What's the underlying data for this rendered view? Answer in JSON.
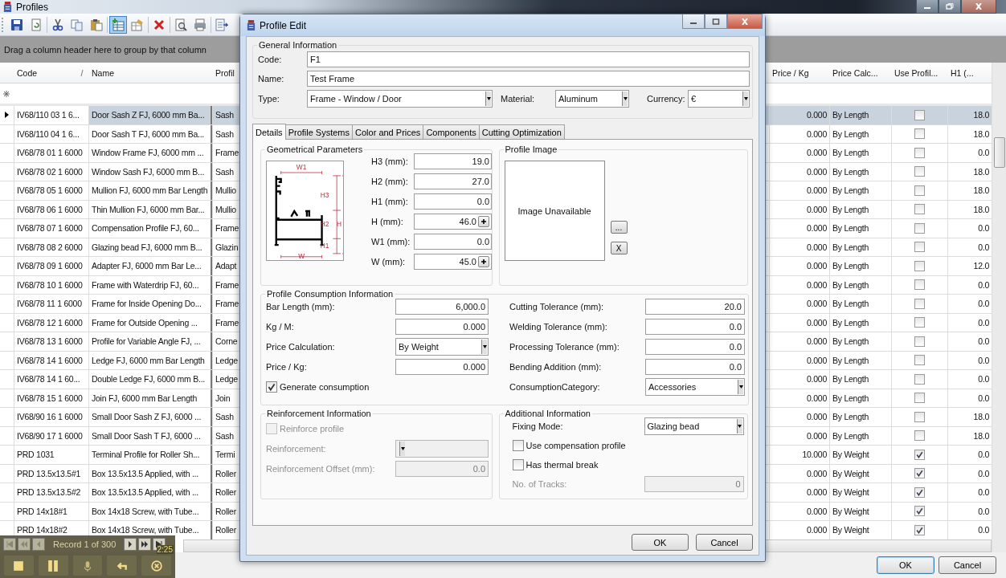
{
  "window": {
    "title": "Profiles"
  },
  "toolbar": [
    [
      {
        "kind": "save",
        "selected": false
      },
      {
        "kind": "refresh",
        "selected": false
      }
    ],
    [
      {
        "kind": "cut",
        "selected": false
      },
      {
        "kind": "copy",
        "selected": false
      },
      {
        "kind": "paste",
        "selected": false
      }
    ],
    [
      {
        "kind": "new",
        "selected": true
      },
      {
        "kind": "edit",
        "selected": false
      }
    ],
    [
      {
        "kind": "delete",
        "selected": false
      }
    ],
    [
      {
        "kind": "preview",
        "selected": false
      },
      {
        "kind": "print",
        "selected": false
      }
    ],
    [
      {
        "kind": "export",
        "selected": false
      }
    ]
  ],
  "group_hint": "Drag a column header here to group by that column",
  "table": {
    "columns_left": [
      {
        "label": "Code",
        "sorted": true
      },
      {
        "label": "Name",
        "sorted": false
      },
      {
        "label": "Profil",
        "sorted": false
      }
    ],
    "columns_right": [
      "Price / Kg",
      "Price Calc...",
      "Use Profil...",
      "H1 (..."
    ],
    "rows": [
      {
        "code": "IV68/110 03 1 6...",
        "name": "Door Sash Z FJ, 6000 mm Ba...",
        "profile": "Sash",
        "price": "0.000",
        "calc": "By Length",
        "use_profile": false,
        "h1": "18.0",
        "selected": true
      },
      {
        "code": "IV68/110 04 1 6...",
        "name": "Door Sash T FJ, 6000 mm Ba...",
        "profile": "Sash",
        "price": "0.000",
        "calc": "By Length",
        "use_profile": false,
        "h1": "18.0",
        "selected": false
      },
      {
        "code": "IV68/78 01 1 6000",
        "name": "Window Frame FJ, 6000 mm ...",
        "profile": "Frame",
        "price": "0.000",
        "calc": "By Length",
        "use_profile": false,
        "h1": "0.0",
        "selected": false
      },
      {
        "code": "IV68/78 02 1 6000",
        "name": "Window Sash FJ, 6000 mm B...",
        "profile": "Sash",
        "price": "0.000",
        "calc": "By Length",
        "use_profile": false,
        "h1": "18.0",
        "selected": false
      },
      {
        "code": "IV68/78 05 1 6000",
        "name": "Mullion FJ, 6000 mm Bar Length",
        "profile": "Mullio",
        "price": "0.000",
        "calc": "By Length",
        "use_profile": false,
        "h1": "18.0",
        "selected": false
      },
      {
        "code": "IV68/78 06 1 6000",
        "name": "Thin Mullion FJ, 6000 mm Bar...",
        "profile": "Mullio",
        "price": "0.000",
        "calc": "By Length",
        "use_profile": false,
        "h1": "18.0",
        "selected": false
      },
      {
        "code": "IV68/78 07 1 6000",
        "name": "Compensation Profile FJ, 60...",
        "profile": "Frame",
        "price": "0.000",
        "calc": "By Length",
        "use_profile": false,
        "h1": "0.0",
        "selected": false
      },
      {
        "code": "IV68/78 08 2 6000",
        "name": "Glazing bead FJ, 6000 mm B...",
        "profile": "Glazin",
        "price": "0.000",
        "calc": "By Length",
        "use_profile": false,
        "h1": "0.0",
        "selected": false
      },
      {
        "code": "IV68/78 09 1 6000",
        "name": "Adapter FJ, 6000 mm Bar Le...",
        "profile": "Adapt",
        "price": "0.000",
        "calc": "By Length",
        "use_profile": false,
        "h1": "12.0",
        "selected": false
      },
      {
        "code": "IV68/78 10 1 6000",
        "name": "Frame with Waterdrip FJ, 60...",
        "profile": "Frame",
        "price": "0.000",
        "calc": "By Length",
        "use_profile": false,
        "h1": "0.0",
        "selected": false
      },
      {
        "code": "IV68/78 11 1 6000",
        "name": "Frame for Inside Opening Do...",
        "profile": "Frame",
        "price": "0.000",
        "calc": "By Length",
        "use_profile": false,
        "h1": "0.0",
        "selected": false
      },
      {
        "code": "IV68/78 12 1 6000",
        "name": "Frame for Outside Opening ...",
        "profile": "Frame",
        "price": "0.000",
        "calc": "By Length",
        "use_profile": false,
        "h1": "0.0",
        "selected": false
      },
      {
        "code": "IV68/78 13 1 6000",
        "name": "Profile for Variable Angle FJ, ...",
        "profile": "Corne",
        "price": "0.000",
        "calc": "By Length",
        "use_profile": false,
        "h1": "0.0",
        "selected": false
      },
      {
        "code": "IV68/78 14 1 6000",
        "name": "Ledge FJ, 6000 mm Bar Length",
        "profile": "Ledge",
        "price": "0.000",
        "calc": "By Length",
        "use_profile": false,
        "h1": "0.0",
        "selected": false
      },
      {
        "code": "IV68/78 14 1 60...",
        "name": "Double Ledge FJ, 6000 mm B...",
        "profile": "Ledge",
        "price": "0.000",
        "calc": "By Length",
        "use_profile": false,
        "h1": "0.0",
        "selected": false
      },
      {
        "code": "IV68/78 15 1 6000",
        "name": "Join FJ, 6000 mm Bar Length",
        "profile": "Join",
        "price": "0.000",
        "calc": "By Length",
        "use_profile": false,
        "h1": "0.0",
        "selected": false
      },
      {
        "code": "IV68/90 16 1 6000",
        "name": "Small Door Sash Z FJ, 6000 ...",
        "profile": "Sash",
        "price": "0.000",
        "calc": "By Length",
        "use_profile": false,
        "h1": "18.0",
        "selected": false
      },
      {
        "code": "IV68/90 17 1 6000",
        "name": "Small Door Sash T FJ, 6000 ...",
        "profile": "Sash",
        "price": "0.000",
        "calc": "By Length",
        "use_profile": false,
        "h1": "18.0",
        "selected": false
      },
      {
        "code": "PRD 1031",
        "name": "Terminal Profile for Roller Sh...",
        "profile": "Termi",
        "price": "10.000",
        "calc": "By Weight",
        "use_profile": true,
        "h1": "0.0",
        "selected": false
      },
      {
        "code": "PRD 13.5x13.5#1",
        "name": "Box 13.5x13.5 Applied, with ...",
        "profile": "Roller",
        "price": "0.000",
        "calc": "By Weight",
        "use_profile": true,
        "h1": "0.0",
        "selected": false
      },
      {
        "code": "PRD 13.5x13.5#2",
        "name": "Box 13.5x13.5 Applied, with ...",
        "profile": "Roller",
        "price": "0.000",
        "calc": "By Weight",
        "use_profile": true,
        "h1": "0.0",
        "selected": false
      },
      {
        "code": "PRD 14x18#1",
        "name": "Box 14x18 Screw, with Tube...",
        "profile": "Roller",
        "price": "0.000",
        "calc": "By Weight",
        "use_profile": true,
        "h1": "0.0",
        "selected": false
      },
      {
        "code": "PRD 14x18#2",
        "name": "Box 14x18 Screw, with Tube...",
        "profile": "Roller",
        "price": "0.000",
        "calc": "By Weight",
        "use_profile": true,
        "h1": "0.0",
        "selected": false
      }
    ]
  },
  "navigator": {
    "record": "Record 1 of 300",
    "time": "2:25"
  },
  "buttons": [
    "OK",
    "Cancel"
  ],
  "dialog": {
    "title": "Profile Edit",
    "general": {
      "title": "General Information",
      "code": {
        "label": "Code:",
        "value": "F1"
      },
      "name": {
        "label": "Name:",
        "value": "Test Frame"
      },
      "type": {
        "label": "Type:",
        "value": "Frame - Window / Door"
      },
      "material": {
        "label": "Material:",
        "value": "Aluminum"
      },
      "currency": {
        "label": "Currency:",
        "value": "€"
      }
    },
    "tabs": [
      {
        "label": "Details",
        "selected": true
      },
      {
        "label": "Profile Systems",
        "selected": false
      },
      {
        "label": "Color and Prices",
        "selected": false
      },
      {
        "label": "Components",
        "selected": false
      },
      {
        "label": "Cutting Optimization",
        "selected": false
      }
    ],
    "geometry": {
      "title": "Geometrical Parameters",
      "diagram_labels": [
        "W1",
        "H3",
        "H2",
        "H1",
        "H",
        "W"
      ],
      "fields": [
        {
          "label": "H3 (mm):",
          "value": "19.0",
          "spin": false
        },
        {
          "label": "H2 (mm):",
          "value": "27.0",
          "spin": false
        },
        {
          "label": "H1 (mm):",
          "value": "0.0",
          "spin": false
        },
        {
          "label": "H (mm):",
          "value": "46.0",
          "spin": true
        },
        {
          "label": "W1 (mm):",
          "value": "0.0",
          "spin": false
        },
        {
          "label": "W (mm):",
          "value": "45.0",
          "spin": true
        }
      ]
    },
    "image": {
      "title": "Profile Image",
      "placeholder": "Image Unavailable",
      "buttons": [
        "...",
        "X"
      ]
    },
    "consumption": {
      "title": "Profile Consumption Information",
      "left": [
        {
          "kind": "input",
          "label": "Bar Length (mm):",
          "value": "6,000.0",
          "disabled": false
        },
        {
          "kind": "input",
          "label": "Kg / M:",
          "value": "0.000",
          "disabled": false
        },
        {
          "kind": "combo",
          "label": "Price Calculation:",
          "value": "By Weight",
          "disabled": false
        },
        {
          "kind": "input",
          "label": "Price / Kg:",
          "value": "0.000",
          "disabled": false
        },
        {
          "kind": "checkbox",
          "label": "Generate consumption",
          "checked": true,
          "disabled": false
        }
      ],
      "right": [
        {
          "kind": "input",
          "label": "Cutting Tolerance (mm):",
          "value": "20.0",
          "disabled": false
        },
        {
          "kind": "input",
          "label": "Welding Tolerance (mm):",
          "value": "0.0",
          "disabled": false
        },
        {
          "kind": "input",
          "label": "Processing Tolerance (mm):",
          "value": "0.0",
          "disabled": false
        },
        {
          "kind": "input",
          "label": "Bending Addition (mm):",
          "value": "0.0",
          "disabled": false
        },
        {
          "kind": "combo",
          "label": "ConsumptionCategory:",
          "value": "Accessories",
          "disabled": false
        }
      ]
    },
    "reinforcement": {
      "title": "Reinforcement Information",
      "items": [
        {
          "kind": "checkbox",
          "label": "Reinforce profile",
          "checked": false,
          "disabled": true
        },
        {
          "kind": "combo",
          "label": "Reinforcement:",
          "disabled": true
        },
        {
          "kind": "input",
          "label": "Reinforcement Offset (mm):",
          "value": "0.0",
          "disabled": true
        }
      ]
    },
    "additional": {
      "title": "Additional Information",
      "items": [
        {
          "kind": "combo",
          "label": "Fixing Mode:",
          "value": "Glazing bead",
          "disabled": false
        },
        {
          "kind": "checkbox",
          "label": "Use compensation profile",
          "checked": false,
          "disabled": false
        },
        {
          "kind": "checkbox",
          "label": "Has thermal break",
          "checked": false,
          "disabled": false
        },
        {
          "kind": "input",
          "label": "No. of Tracks:",
          "value": "0",
          "disabled": true
        }
      ]
    },
    "buttons": [
      "OK",
      "Cancel"
    ]
  }
}
